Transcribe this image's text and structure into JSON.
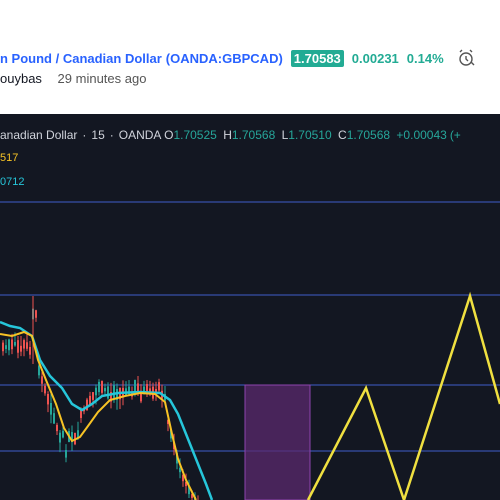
{
  "header": {
    "pair_title": "n Pound / Canadian Dollar",
    "symbol": "(OANDA:GBPCAD)",
    "price": "1.70583",
    "change": "0.00231",
    "change_pct": "0.14%",
    "author": "ouybas",
    "time_ago": "29 minutes ago"
  },
  "legend": {
    "title": "anadian Dollar",
    "interval": "15",
    "exchange": "OANDA",
    "o_label": "O",
    "o_value": "1.70525",
    "h_label": "H",
    "h_value": "1.70568",
    "l_label": "L",
    "l_value": "1.70510",
    "c_label": "C",
    "c_value": "1.70568",
    "change": "+0.00043",
    "trail": "(+"
  },
  "indicators": {
    "ma1_value": "517",
    "ma2_value": "0712"
  },
  "colors": {
    "chart_bg": "#131722",
    "up": "#26a69a",
    "down": "#ef5350",
    "ma_yellow": "#f7c325",
    "ma_cyan": "#26c6da",
    "hline": "#3f5ec9",
    "zigzag": "#f0e040",
    "zone": "#5b2a6e"
  }
}
